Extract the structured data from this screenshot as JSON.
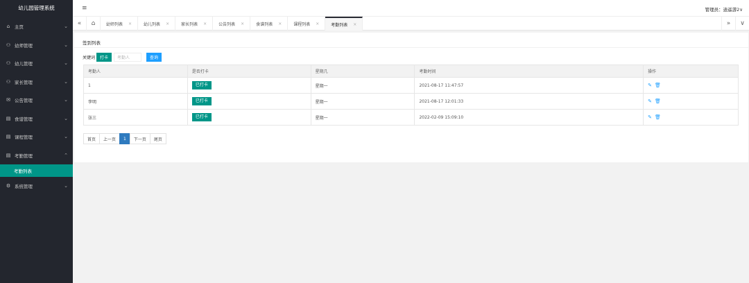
{
  "app": {
    "title": "幼儿园管理系统"
  },
  "header": {
    "menu_icon": "≡",
    "user_label": "管理员：逍遥游2",
    "user_chevron": "∨"
  },
  "sidebar": {
    "items": [
      {
        "icon": "⌂",
        "label": "主页"
      },
      {
        "icon": "⚇",
        "label": "幼师管理"
      },
      {
        "icon": "⚇",
        "label": "幼儿管理"
      },
      {
        "icon": "⚇",
        "label": "家长管理"
      },
      {
        "icon": "✉",
        "label": "公告管理"
      },
      {
        "icon": "▤",
        "label": "食谱管理"
      },
      {
        "icon": "▤",
        "label": "课程管理"
      },
      {
        "icon": "▤",
        "label": "考勤管理"
      },
      {
        "icon": "⚙",
        "label": "系统管理"
      }
    ],
    "active_sub": "考勤列表"
  },
  "tabs": {
    "prev": "«",
    "home": "⌂",
    "next": "»",
    "more": "∨",
    "items": [
      "幼师列表",
      "幼儿列表",
      "家长列表",
      "公告列表",
      "食谱列表",
      "课程列表",
      "考勤列表"
    ],
    "active": "考勤列表",
    "close": "×"
  },
  "card": {
    "title": "签到列表",
    "search_label": "关键词",
    "checkin_button": "打卡",
    "search_placeholder": "考勤人",
    "query_button": "查询"
  },
  "table": {
    "headers": [
      "考勤人",
      "是否打卡",
      "星期几",
      "考勤时间",
      "操作"
    ],
    "rows": [
      {
        "name": "1",
        "status": "已打卡",
        "weekday": "星期一",
        "time": "2021-08-17 11:47:57"
      },
      {
        "name": "李明",
        "status": "已打卡",
        "weekday": "星期一",
        "time": "2021-08-17 12:01:33"
      },
      {
        "name": "张三",
        "status": "已打卡",
        "weekday": "星期一",
        "time": "2022-02-09 15:09:10"
      }
    ],
    "edit_icon": "✎",
    "delete_icon": "🗑"
  },
  "pager": {
    "first": "首页",
    "prev": "上一页",
    "current": "1",
    "next": "下一页",
    "last": "尾页"
  }
}
